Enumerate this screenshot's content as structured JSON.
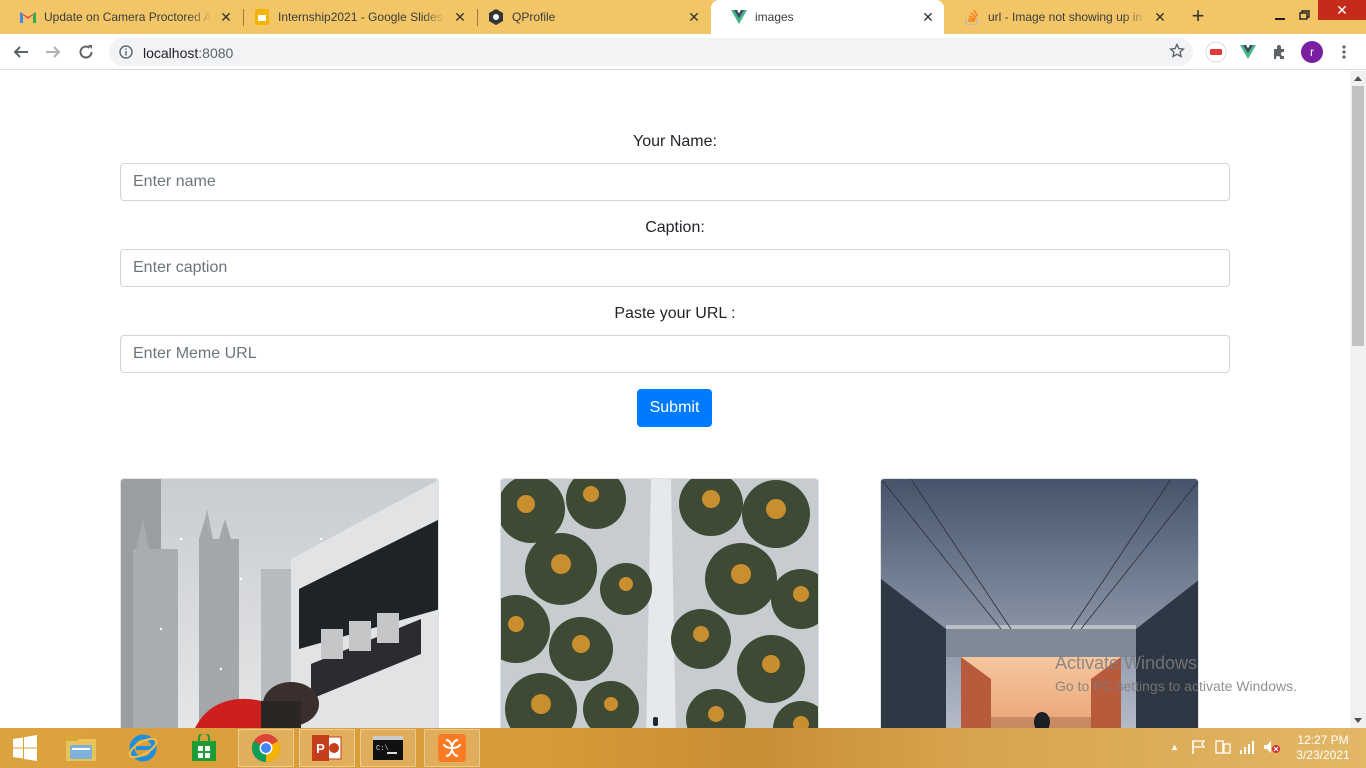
{
  "browser": {
    "tabs": [
      {
        "title": "Update on Camera Proctored Assessment",
        "icon": "gmail-icon",
        "active": false
      },
      {
        "title": "Internship2021 - Google Slides",
        "icon": "slides-icon",
        "active": false
      },
      {
        "title": "QProfile",
        "icon": "qprofile-icon",
        "active": false
      },
      {
        "title": "images",
        "icon": "vue-icon",
        "active": true
      },
      {
        "title": "url - Image not showing up in React",
        "icon": "stackoverflow-icon",
        "active": false
      }
    ],
    "url_host": "localhost",
    "url_port": ":8080",
    "profile_initial": "r"
  },
  "form": {
    "name_label": "Your Name:",
    "name_placeholder": "Enter name",
    "caption_label": "Caption:",
    "caption_placeholder": "Enter caption",
    "url_label": "Paste your URL :",
    "url_placeholder": "Enter Meme URL",
    "submit_label": "Submit"
  },
  "memes": [
    {
      "subject": "photographer-with-bus-in-snowy-city"
    },
    {
      "subject": "aerial-view-of-snowy-pine-forest"
    },
    {
      "subject": "person-walking-under-bridge-at-sunset"
    }
  ],
  "watermark": {
    "title": "Activate Windows",
    "subtitle": "Go to PC settings to activate Windows."
  },
  "taskbar": {
    "apps": [
      "file-explorer-icon",
      "internet-explorer-icon",
      "store-icon",
      "chrome-icon",
      "powerpoint-icon",
      "command-prompt-icon",
      "xampp-icon"
    ],
    "time": "12:27 PM",
    "date": "3/23/2021"
  },
  "colors": {
    "accent": "#007bff",
    "tabbar": "#f2c667",
    "taskbar": "#d89a36"
  }
}
